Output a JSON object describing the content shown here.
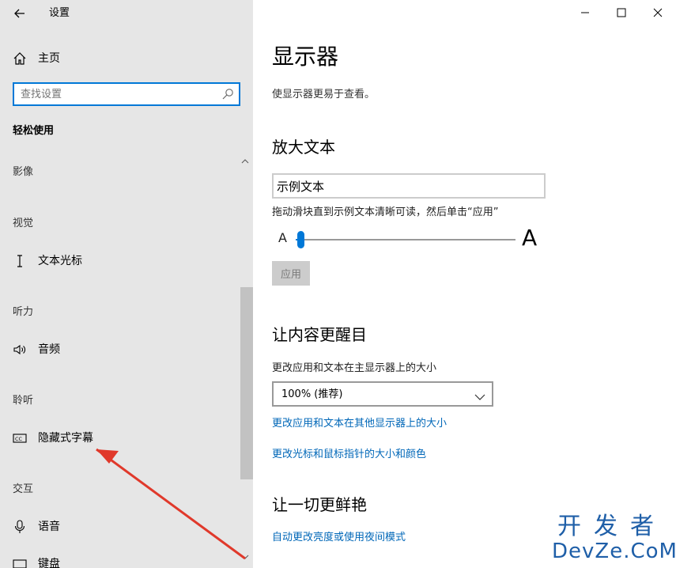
{
  "window": {
    "title": "设置",
    "controls": {
      "minimize": "—",
      "maximize": "☐",
      "close": "✕"
    }
  },
  "sidebar": {
    "back_icon": "back-arrow-icon",
    "home": {
      "label": "主页",
      "icon": "home-icon"
    },
    "search": {
      "placeholder": "查找设置",
      "icon": "search-icon"
    },
    "section_title": "轻松使用",
    "categories": {
      "imaging": "影像",
      "vision": "视觉",
      "hearing": "听力",
      "listening": "聆听",
      "interaction": "交互"
    },
    "items": {
      "text_cursor": {
        "label": "文本光标",
        "icon": "text-cursor-icon"
      },
      "audio": {
        "label": "音频",
        "icon": "speaker-icon"
      },
      "captions": {
        "label": "隐藏式字幕",
        "icon": "closed-captions-icon"
      },
      "speech": {
        "label": "语音",
        "icon": "microphone-icon"
      },
      "keyboard": {
        "label": "键盘",
        "icon": "keyboard-icon"
      }
    },
    "annotation_arrow_color": "#e0392b"
  },
  "main": {
    "title": "显示器",
    "subtitle": "使显示器更易于查看。",
    "enlarge_text": {
      "heading": "放大文本",
      "sample_text": "示例文本",
      "hint": "拖动滑块直到示例文本清晰可读，然后单击“应用”",
      "slider_small_label": "A",
      "slider_large_label": "A",
      "slider_value_fraction": 0.02,
      "apply_label": "应用"
    },
    "make_bigger": {
      "heading": "让内容更醒目",
      "scale_label": "更改应用和文本在主显示器上的大小",
      "scale_value": "100% (推荐)",
      "link_other_displays": "更改应用和文本在其他显示器上的大小",
      "link_cursor": "更改光标和鼠标指针的大小和颜色"
    },
    "brighter": {
      "heading": "让一切更鲜艳",
      "link_brightness": "自动更改亮度或使用夜间模式"
    }
  },
  "watermark": {
    "top": "开发者",
    "bottom": "DevZe.CoM"
  },
  "colors": {
    "accent": "#0078d7",
    "link": "#0067b8",
    "sidebar_bg": "#e6e6e6",
    "watermark": "#1f5fa8"
  }
}
